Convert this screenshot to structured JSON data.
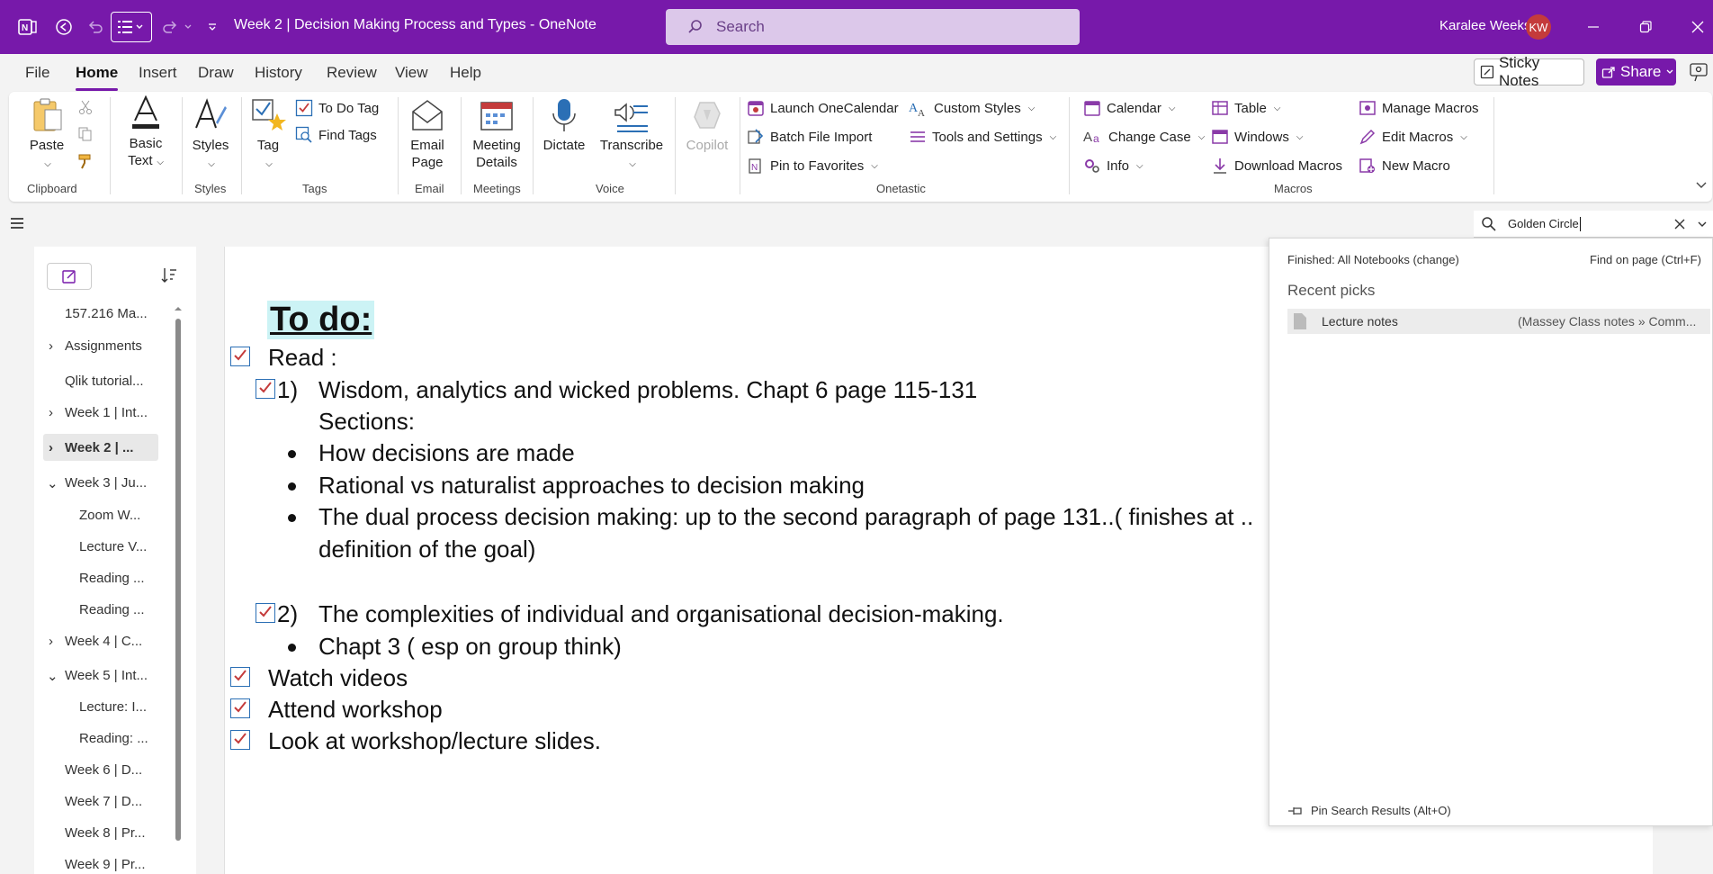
{
  "titlebar": {
    "document_title": "Week 2 | Decision Making Process and Types  -  OneNote",
    "search_placeholder": "Search",
    "user_name": "Karalee Weeks",
    "user_initials": "KW"
  },
  "menu": {
    "tabs": [
      "File",
      "Home",
      "Insert",
      "Draw",
      "History",
      "Review",
      "View",
      "Help"
    ],
    "active": "Home",
    "sticky_notes": "Sticky Notes",
    "share": "Share"
  },
  "ribbon": {
    "clipboard": {
      "paste": "Paste",
      "label": "Clipboard"
    },
    "basic_text": {
      "line1": "Basic",
      "line2": "Text"
    },
    "styles": {
      "button": "Styles",
      "label": "Styles"
    },
    "tags": {
      "tag": "Tag",
      "todo": "To Do Tag",
      "find": "Find Tags",
      "label": "Tags"
    },
    "email": {
      "line1": "Email",
      "line2": "Page",
      "label": "Email"
    },
    "meetings": {
      "line1": "Meeting",
      "line2": "Details",
      "label": "Meetings"
    },
    "voice": {
      "dictate": "Dictate",
      "transcribe": "Transcribe",
      "label": "Voice"
    },
    "copilot": "Copilot",
    "onetastic": {
      "launch": "Launch OneCalendar",
      "batch": "Batch File Import",
      "pin": "Pin to Favorites",
      "custom_styles": "Custom Styles",
      "tools": "Tools and Settings",
      "label": "Onetastic"
    },
    "macros": {
      "calendar": "Calendar",
      "change_case": "Change Case",
      "info": "Info",
      "table": "Table",
      "windows": "Windows",
      "download": "Download Macros",
      "manage": "Manage Macros",
      "edit": "Edit Macros",
      "new": "New Macro",
      "label": "Macros"
    }
  },
  "find": {
    "query": "Golden Circle"
  },
  "sidebar": {
    "pages": [
      "157.216 Ma...",
      "Assignments",
      "Qlik tutorial...",
      "Week 1 | Int...",
      "Week 2 | ...",
      "Week 3 | Ju...",
      "Zoom W...",
      "Lecture V...",
      "Reading ...",
      "Reading ...",
      "Week 4 | C...",
      "Week 5 | Int...",
      "Lecture: I...",
      "Reading: ...",
      "Week 6 | D...",
      "Week 7 | D...",
      "Week 8 | Pr...",
      "Week 9 | Pr..."
    ]
  },
  "note": {
    "title": "To do:",
    "read": "Read :",
    "item1_num": "1)",
    "item1": "Wisdom, analytics and wicked problems.  Chapt 6 page 115-131",
    "sections": "Sections:",
    "bullet1": "How decisions are made",
    "bullet2": "Rational vs naturalist approaches to decision making",
    "bullet3a": "The dual process decision making: up to the second paragraph of page 131..( finishes at ..",
    "bullet3b": "definition of the goal)",
    "item2_num": "2)",
    "item2": "The complexities of individual and organisational decision-making.",
    "bullet4": "Chapt 3 ( esp on group think)",
    "watch": "Watch videos",
    "attend": "Attend workshop",
    "look": "Look at workshop/lecture slides."
  },
  "search_pane": {
    "finished": "Finished:  All Notebooks (change)",
    "find_on_page": "Find on page (Ctrl+F)",
    "recent_picks": "Recent picks",
    "result_title": "Lecture notes",
    "result_path": "(Massey Class notes » Comm...",
    "pin_results": "Pin Search Results (Alt+O)"
  }
}
